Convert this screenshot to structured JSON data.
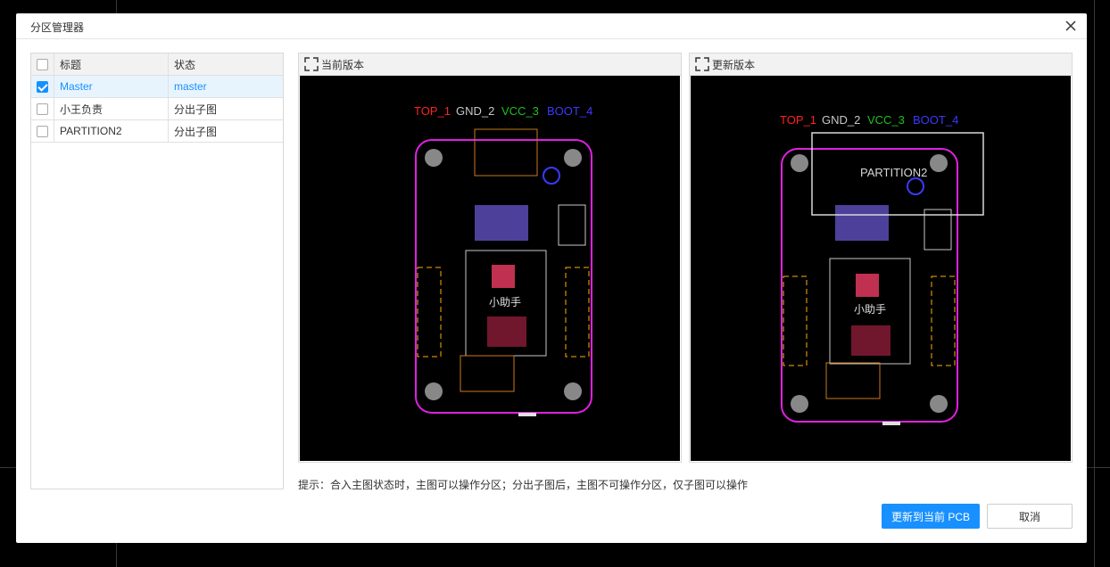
{
  "dialog": {
    "title": "分区管理器"
  },
  "partition_table": {
    "columns": [
      "标题",
      "状态"
    ],
    "rows": [
      {
        "title": "Master",
        "status": "master",
        "checked": true
      },
      {
        "title": "小王负责",
        "status": "分出子图",
        "checked": false
      },
      {
        "title": "PARTITION2",
        "status": "分出子图",
        "checked": false
      }
    ]
  },
  "preview": {
    "current_label": "当前版本",
    "updated_label": "更新版本",
    "layers": [
      {
        "name": "TOP_1",
        "color": "#ff2020"
      },
      {
        "name": "GND_2",
        "color": "#c8c8c8"
      },
      {
        "name": "VCC_3",
        "color": "#1fc01f"
      },
      {
        "name": "BOOT_4",
        "color": "#3a3aff"
      }
    ],
    "partition_name": "PARTITION2",
    "board_label": "小助手"
  },
  "hint": "提示：合入主图状态时，主图可以操作分区；分出子图后，主图不可操作分区，仅子图可以操作",
  "buttons": {
    "update": "更新到当前 PCB",
    "cancel": "取消"
  },
  "colors": {
    "accent": "#1890ff",
    "board_outline": "#e020e0",
    "pad": "#ffb000"
  }
}
